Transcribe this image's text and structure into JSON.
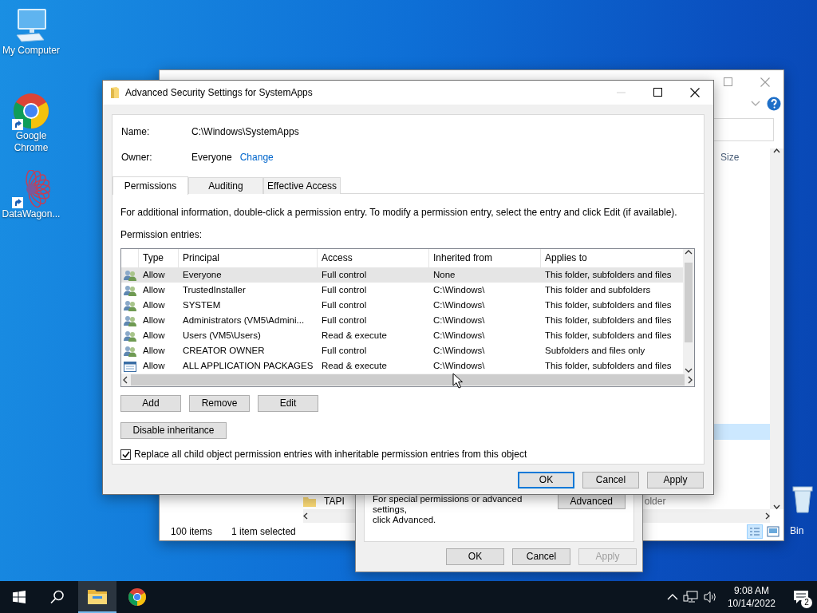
{
  "desktop_icons": [
    {
      "kind": "computer",
      "label": "My Computer",
      "shortcut": false
    },
    {
      "kind": "chrome",
      "label": "Google Chrome",
      "shortcut": true
    },
    {
      "kind": "mandala",
      "label": "DataWagon...",
      "shortcut": true
    },
    {
      "kind": "recycle",
      "label": "Bin"
    }
  ],
  "explorer": {
    "column_header": "Size",
    "item": {
      "name": "TAPI",
      "type": "older"
    },
    "status": [
      "100 items",
      "1 item selected"
    ]
  },
  "properties_dialog": {
    "hint_lines": [
      "For special permissions or advanced settings,",
      "click Advanced."
    ],
    "advanced_button": "Advanced",
    "buttons": [
      {
        "label": "OK",
        "disabled": false
      },
      {
        "label": "Cancel",
        "disabled": false
      },
      {
        "label": "Apply",
        "disabled": true
      }
    ]
  },
  "dialog": {
    "title": "Advanced Security Settings for SystemApps",
    "name_label": "Name:",
    "name_value": "C:\\Windows\\SystemApps",
    "owner_label": "Owner:",
    "owner_value": "Everyone",
    "owner_link": "Change",
    "tabs": [
      {
        "label": "Permissions",
        "selected": true
      },
      {
        "label": "Auditing",
        "selected": false
      },
      {
        "label": "Effective Access",
        "selected": false
      }
    ],
    "info": "For additional information, double-click a permission entry. To modify a permission entry, select the entry and click Edit (if available).",
    "entries_label": "Permission entries:",
    "table": {
      "columns": [
        "Type",
        "Principal",
        "Access",
        "Inherited from",
        "Applies to"
      ],
      "rows": [
        {
          "kind": "group",
          "selected": true,
          "cells": [
            "Allow",
            "Everyone",
            "Full control",
            "None",
            "This folder, subfolders and files"
          ]
        },
        {
          "kind": "group",
          "selected": false,
          "cells": [
            "Allow",
            "TrustedInstaller",
            "Full control",
            "C:\\Windows\\",
            "This folder and subfolders"
          ]
        },
        {
          "kind": "group",
          "selected": false,
          "cells": [
            "Allow",
            "SYSTEM",
            "Full control",
            "C:\\Windows\\",
            "This folder, subfolders and files"
          ]
        },
        {
          "kind": "group",
          "selected": false,
          "cells": [
            "Allow",
            "Administrators (VM5\\Admini...",
            "Full control",
            "C:\\Windows\\",
            "This folder, subfolders and files"
          ]
        },
        {
          "kind": "group",
          "selected": false,
          "cells": [
            "Allow",
            "Users (VM5\\Users)",
            "Read & execute",
            "C:\\Windows\\",
            "This folder, subfolders and files"
          ]
        },
        {
          "kind": "group",
          "selected": false,
          "cells": [
            "Allow",
            "CREATOR OWNER",
            "Full control",
            "C:\\Windows\\",
            "Subfolders and files only"
          ]
        },
        {
          "kind": "package",
          "selected": false,
          "cells": [
            "Allow",
            "ALL APPLICATION PACKAGES",
            "Read & execute",
            "C:\\Windows\\",
            "This folder, subfolders and files"
          ]
        }
      ]
    },
    "entry_buttons": [
      "Add",
      "Remove",
      "Edit"
    ],
    "inheritance_button": "Disable inheritance",
    "replace_checkbox": {
      "label": "Replace all child object permission entries with inheritable permission entries from this object",
      "checked": true
    },
    "buttons": [
      {
        "label": "OK",
        "default": true
      },
      {
        "label": "Cancel",
        "default": false
      },
      {
        "label": "Apply",
        "default": false
      }
    ]
  },
  "taskbar": {
    "apps": [
      {
        "kind": "explorer",
        "active": true
      },
      {
        "kind": "chrome",
        "active": false
      }
    ],
    "time": "9:08 AM",
    "date": "10/14/2022",
    "notifications": "2"
  }
}
